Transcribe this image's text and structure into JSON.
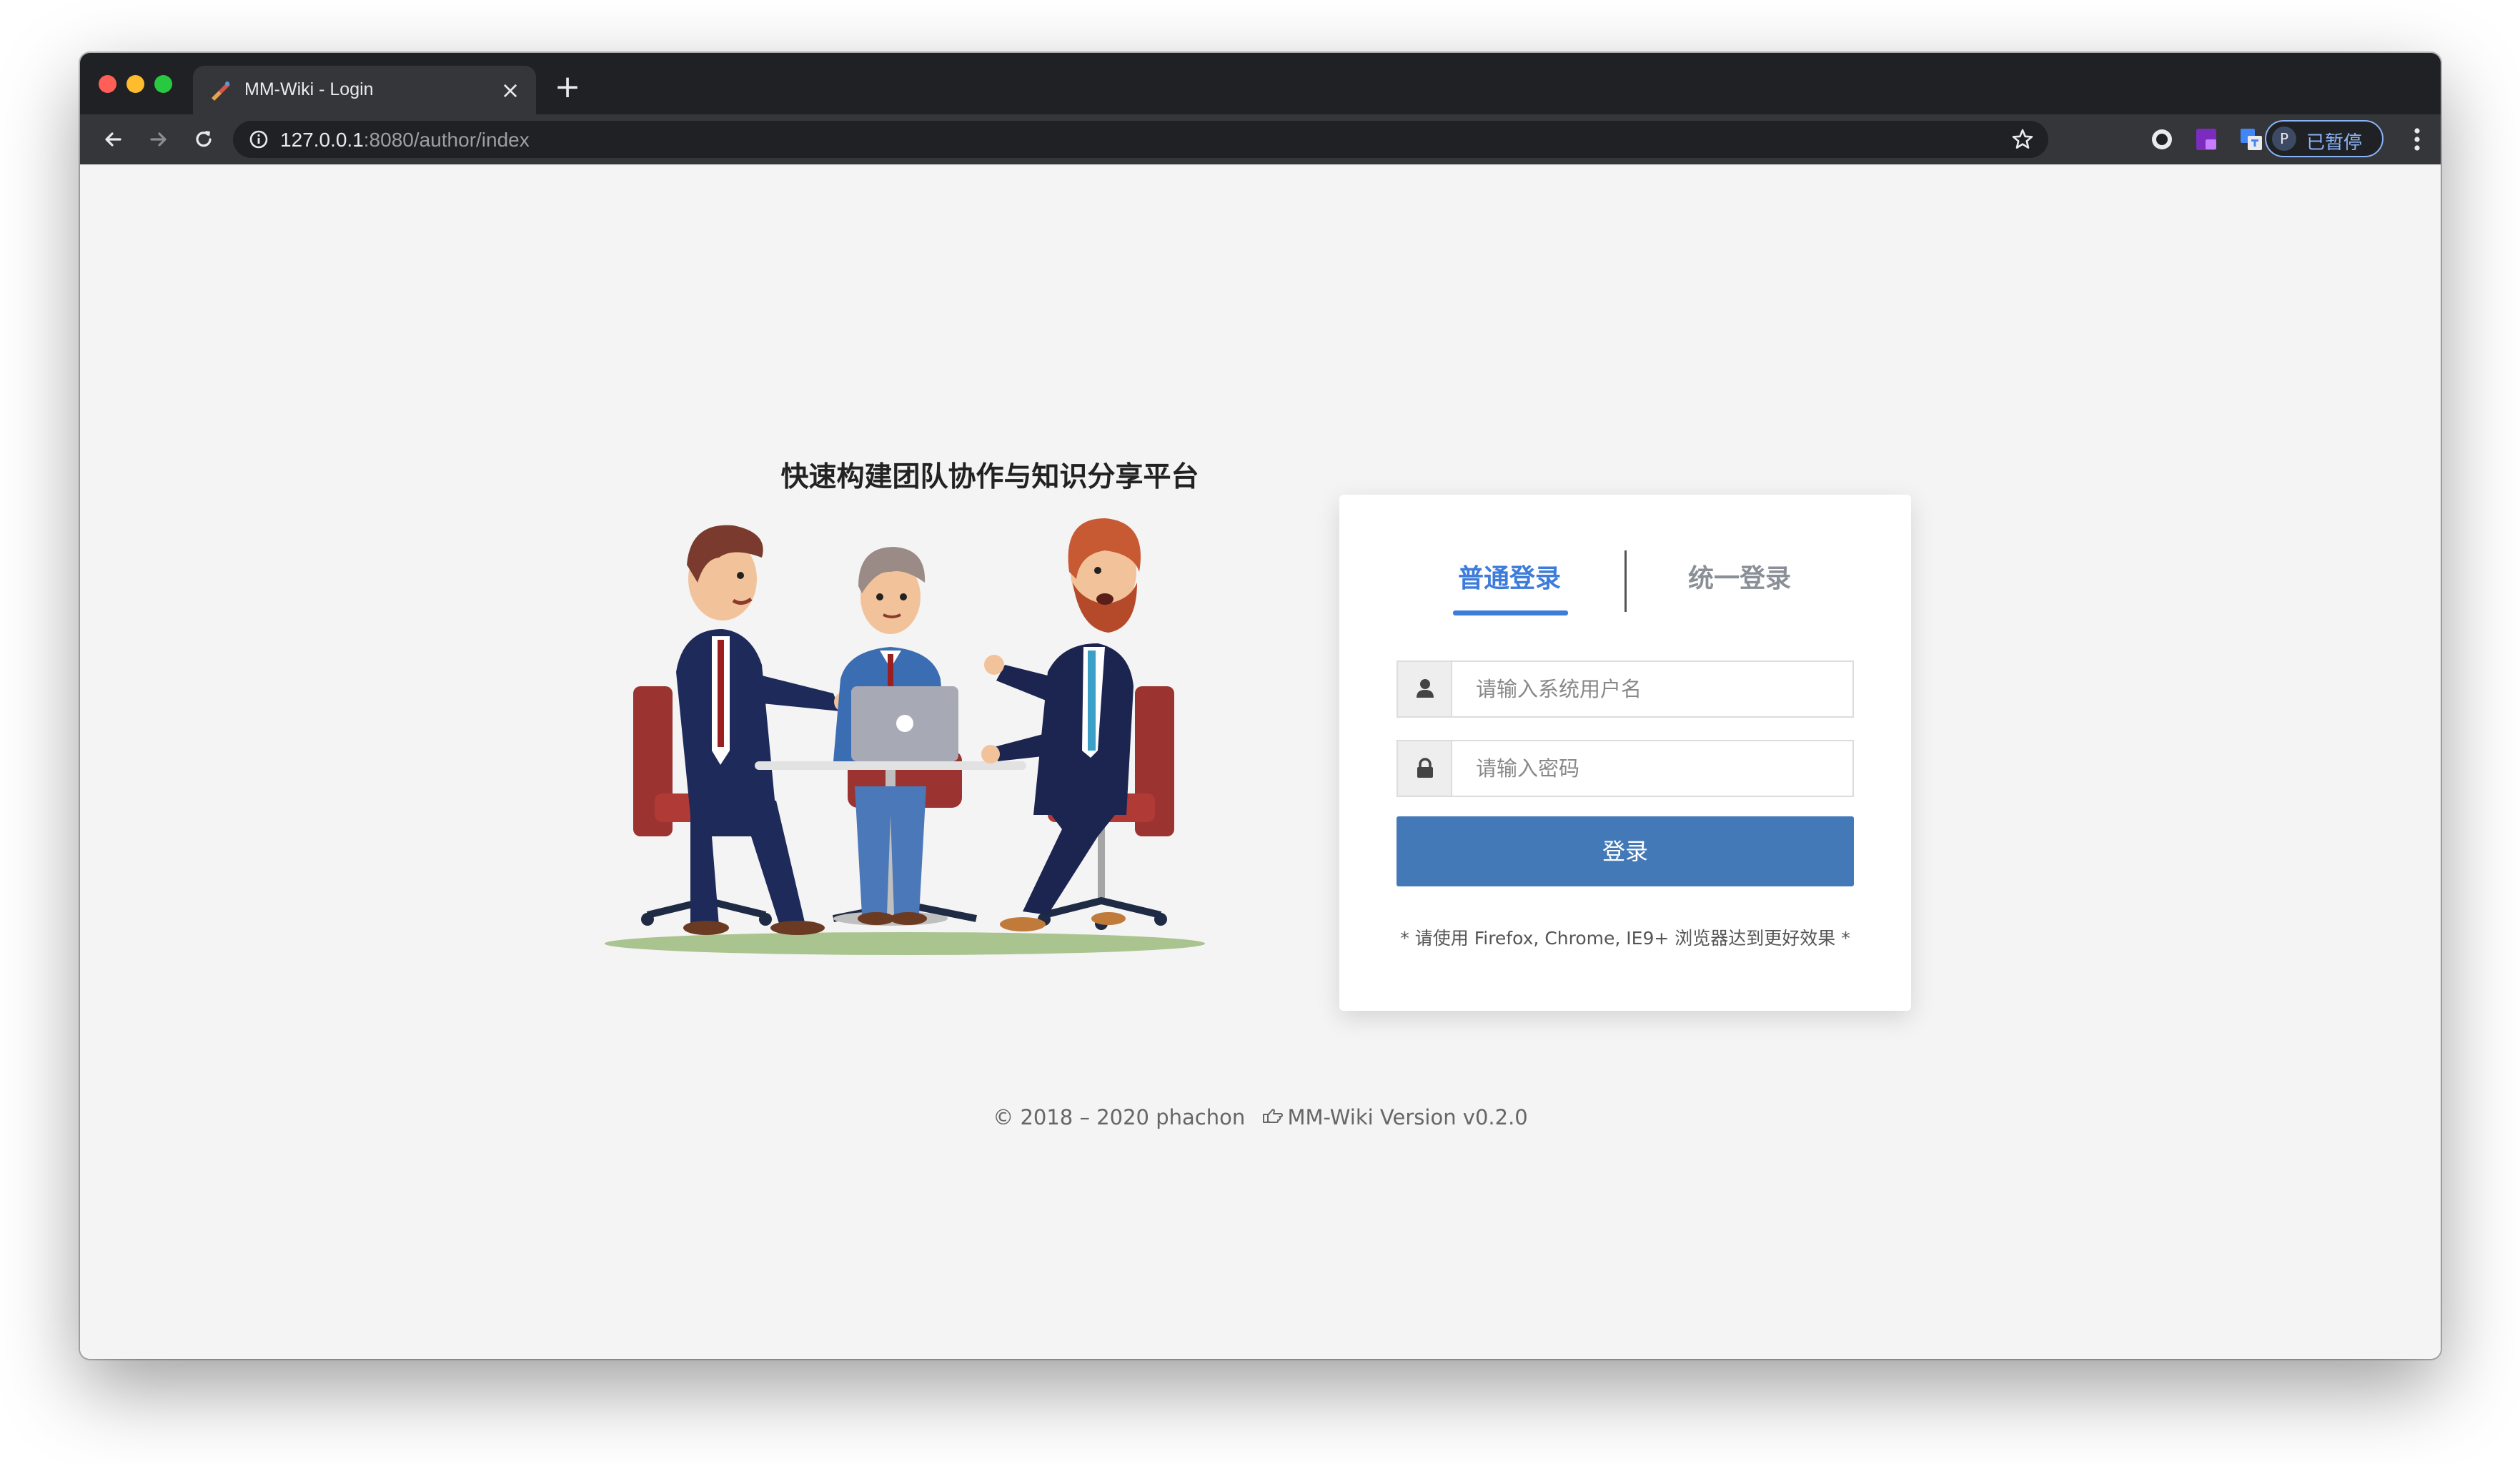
{
  "browser": {
    "tab_title": "MM-Wiki - Login",
    "url_host": "127.0.0.1",
    "url_path": ":8080/author/index",
    "profile_initial": "P",
    "profile_status": "已暂停",
    "accent_color": "#8ab4f8"
  },
  "page": {
    "slogan": "快速构建团队协作与知识分享平台",
    "login_tabs": [
      {
        "label": "普通登录",
        "active": true
      },
      {
        "label": "统一登录",
        "active": false
      }
    ],
    "username_placeholder": "请输入系统用户名",
    "password_placeholder": "请输入密码",
    "login_button": "登录",
    "browser_note": "* 请使用 Firefox, Chrome, IE9+ 浏览器达到更好效果 *",
    "accent_color": "#3d7cdb",
    "button_color": "#4479b8"
  },
  "footer": {
    "copyright": "© 2018 – 2020 phachon",
    "version": "MM-Wiki Version v0.2.0"
  },
  "icons": [
    "back-arrow-icon",
    "forward-arrow-icon",
    "reload-icon",
    "info-icon",
    "star-icon",
    "user-icon",
    "lock-icon",
    "hand-pointer-icon",
    "more-menu-icon"
  ]
}
